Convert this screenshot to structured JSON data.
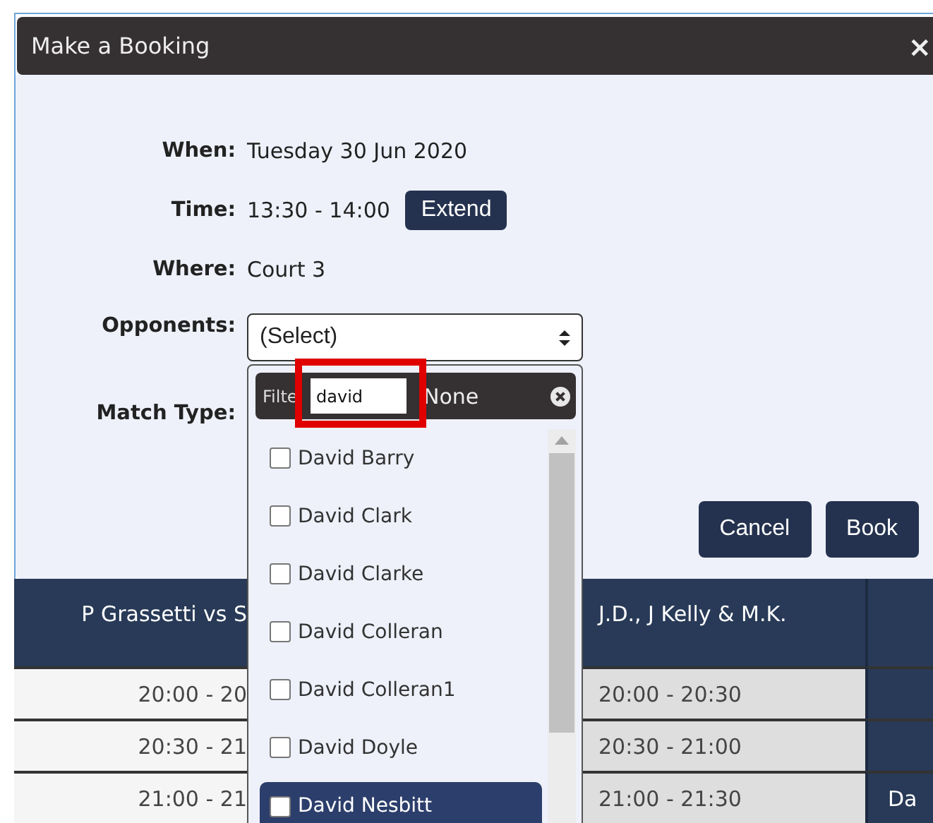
{
  "window": {
    "title": "Make a Booking",
    "close": "×"
  },
  "fields": [
    {
      "label": "When:",
      "kind": "text",
      "value": "Tuesday 30 Jun 2020"
    },
    {
      "label": "Time:",
      "kind": "text",
      "value": "13:30 - 14:00",
      "button": "Extend"
    },
    {
      "label": "Where:",
      "kind": "text",
      "value": "Court 3"
    },
    {
      "label": "Opponents:",
      "kind": "select",
      "value": "(Select)"
    },
    {
      "label": "Match Type:",
      "kind": "covered"
    }
  ],
  "buttons": [
    "Cancel",
    "Book"
  ],
  "dropdown": {
    "filter_label": "Filte",
    "filter_value": "david",
    "highlighted": true,
    "select_none": "None",
    "options": [
      {
        "label": "David Barry",
        "checked": false,
        "selected": false
      },
      {
        "label": "David Clark",
        "checked": false,
        "selected": false
      },
      {
        "label": "David Clarke",
        "checked": false,
        "selected": false
      },
      {
        "label": "David Colleran",
        "checked": false,
        "selected": false
      },
      {
        "label": "David Colleran1",
        "checked": false,
        "selected": false
      },
      {
        "label": "David Doyle",
        "checked": false,
        "selected": false
      },
      {
        "label": "David Nesbitt",
        "checked": false,
        "selected": true
      }
    ]
  },
  "schedule": {
    "header": [
      "P Grassetti vs S",
      "J.D., J Kelly & M.K."
    ],
    "rows": [
      {
        "cells": [
          "20:00 - 20",
          "20:00 - 20:30"
        ]
      },
      {
        "cells": [
          "20:30 - 21",
          "20:30 - 21:00"
        ]
      },
      {
        "cells": [
          "21:00 - 21",
          "21:00 - 21:30"
        ],
        "extra": "Da"
      }
    ]
  }
}
